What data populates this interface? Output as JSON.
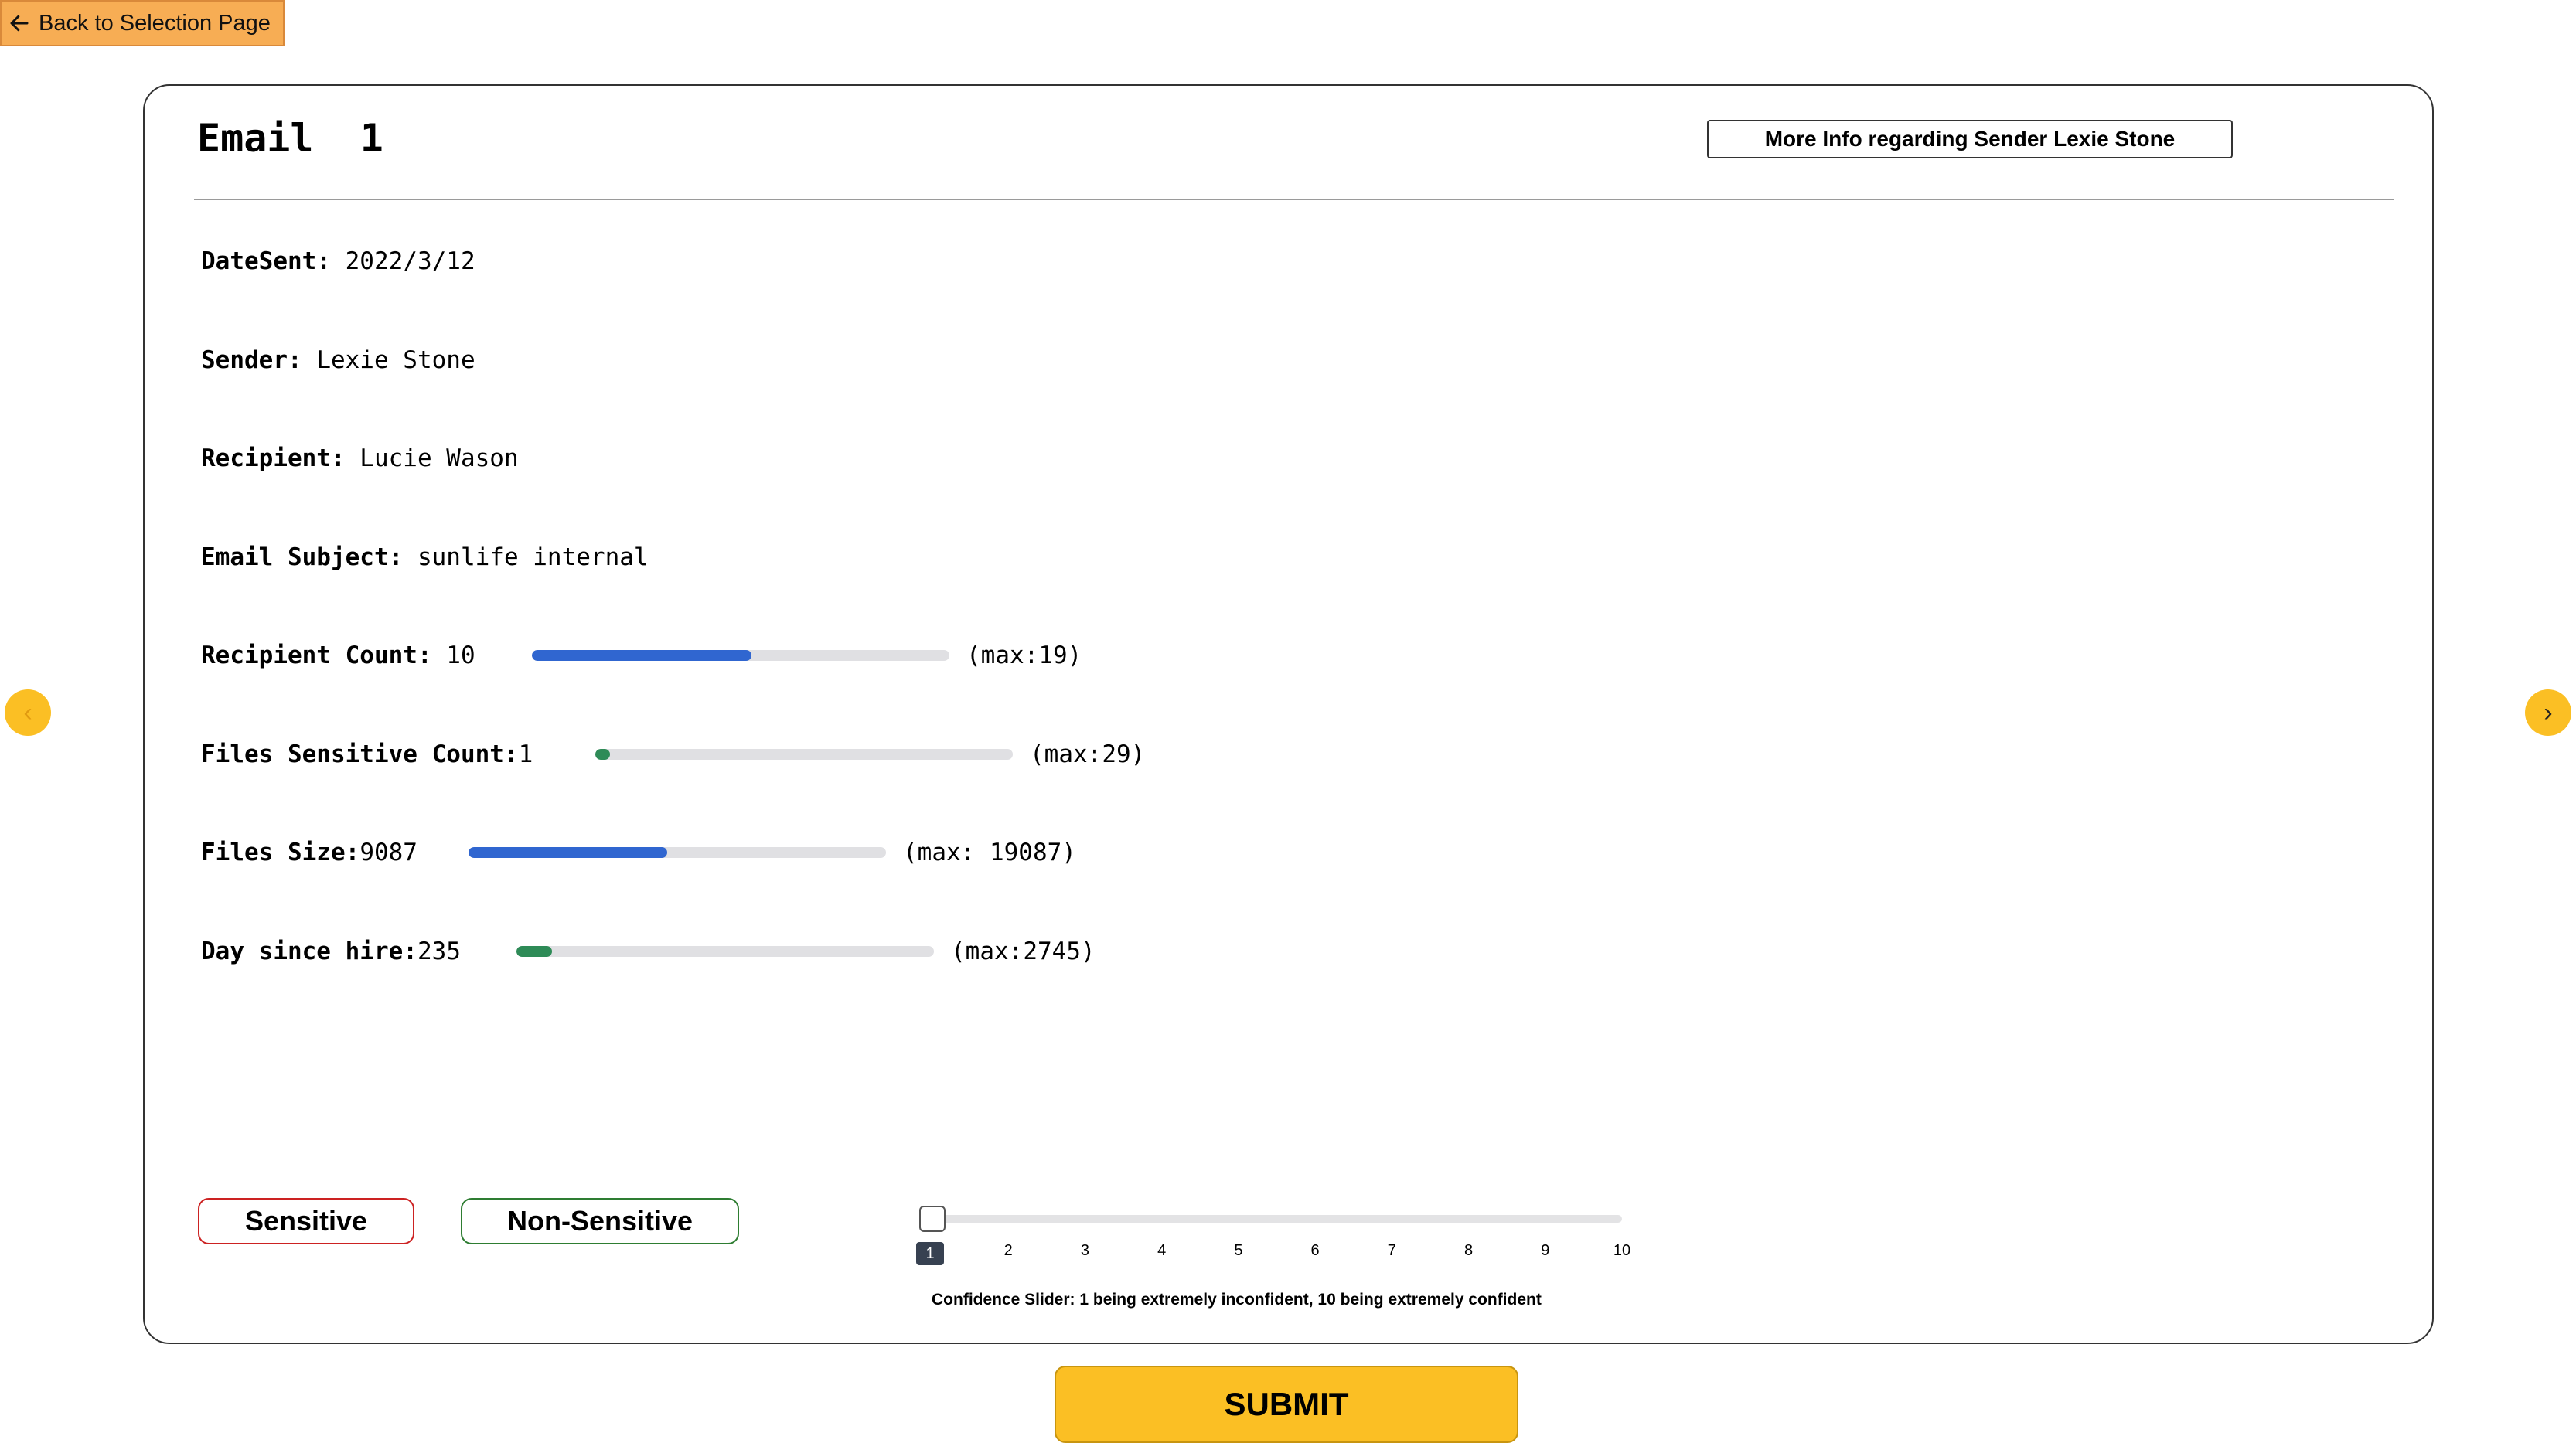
{
  "back_button": {
    "label": "Back to Selection Page",
    "icon": "arrow-left-icon"
  },
  "email": {
    "title": "Email  1",
    "more_info_label": "More Info regarding Sender Lexie Stone",
    "fields": {
      "date_sent": {
        "label": "DateSent:",
        "value": " 2022/3/12"
      },
      "sender": {
        "label": "Sender:",
        "value": " Lexie Stone"
      },
      "recipient": {
        "label": "Recipient:",
        "value": " Lucie Wason"
      },
      "subject": {
        "label": "Email Subject:",
        "value": " sunlife internal"
      }
    },
    "metrics": {
      "recipient_count": {
        "label": "Recipient Count:",
        "value": " 10",
        "max_label": "(max:19)",
        "fraction": 0.526,
        "color": "#3066d0"
      },
      "files_sensitive": {
        "label": "Files Sensitive Count:",
        "value": "1",
        "max_label": "(max:29)",
        "fraction": 0.034,
        "color": "#2e8b57"
      },
      "files_size": {
        "label": "Files Size:",
        "value": "9087",
        "max_label": "(max: 19087)",
        "fraction": 0.476,
        "color": "#3066d0"
      },
      "days_since_hire": {
        "label": "Day since hire:",
        "value": "235",
        "max_label": "(max:2745)",
        "fraction": 0.086,
        "color": "#2e8b57"
      }
    }
  },
  "nav": {
    "prev_icon": "chevron-left-icon",
    "next_icon": "chevron-right-icon",
    "prev": "‹",
    "next": "›"
  },
  "choices": {
    "sensitive": "Sensitive",
    "non_sensitive": "Non-Sensitive",
    "sensitive_color": "#cc2222",
    "non_sensitive_color": "#2e7d32"
  },
  "slider": {
    "value": 1,
    "ticks": [
      "1",
      "2",
      "3",
      "4",
      "5",
      "6",
      "7",
      "8",
      "9",
      "10"
    ],
    "caption": "Confidence Slider: 1 being extremely inconfident, 10 being extremely confident"
  },
  "submit_label": "SUBMIT"
}
